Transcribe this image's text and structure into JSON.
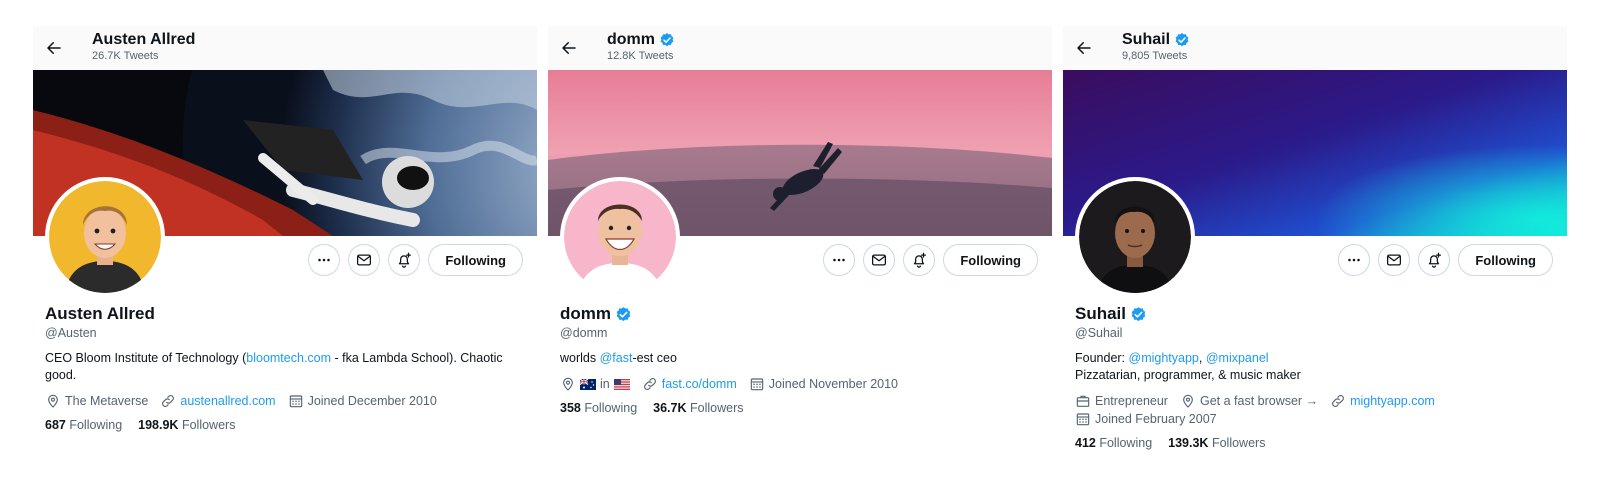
{
  "profiles": [
    {
      "top_name": "Austen Allred",
      "tweets": "26.7K Tweets",
      "verified": false,
      "name": "Austen Allred",
      "handle": "@Austen",
      "bio": {
        "p1": "CEO Bloom Institute of Technology (",
        "link": "bloomtech.com",
        "p2": " - fka Lambda School). Chaotic good."
      },
      "location": "The Metaverse",
      "website": "austenallred.com",
      "joined": "Joined December 2010",
      "following_count": "687",
      "following_label": "Following",
      "followers_count": "198.9K",
      "followers_label": "Followers",
      "follow_button": "Following",
      "banner_desc": "astronaut-in-car-over-earth",
      "avatar_bg": "#f1b82d"
    },
    {
      "top_name": "domm",
      "tweets": "12.8K Tweets",
      "verified": true,
      "name": "domm",
      "handle": "@domm",
      "bio": {
        "p1": "worlds ",
        "link": "@fast",
        "p2": "-est ceo"
      },
      "location_in": "in",
      "website": "fast.co/domm",
      "joined": "Joined November 2010",
      "following_count": "358",
      "following_label": "Following",
      "followers_count": "36.7K",
      "followers_label": "Followers",
      "follow_button": "Following",
      "banner_desc": "skydiver-pink-sky",
      "avatar_bg": "#f7b6c9"
    },
    {
      "top_name": "Suhail",
      "tweets": "9,805 Tweets",
      "verified": true,
      "name": "Suhail",
      "handle": "@Suhail",
      "bio": {
        "l1_p1": "Founder: ",
        "l1_link1": "@mightyapp",
        "l1_sep": ", ",
        "l1_link2": "@mixpanel",
        "line2": "Pizzatarian, programmer, & music maker"
      },
      "category": "Entrepreneur",
      "location": "Get a fast browser →",
      "website": "mightyapp.com",
      "joined": "Joined February 2007",
      "following_count": "412",
      "following_label": "Following",
      "followers_count": "139.3K",
      "followers_label": "Followers",
      "follow_button": "Following",
      "banner_desc": "purple-teal-gradient",
      "avatar_bg": "#1d1a1e"
    }
  ],
  "icons": {
    "back": "arrow-left-icon",
    "more": "more-dots-icon",
    "message": "mail-icon",
    "notify": "bell-plus-icon",
    "location": "location-pin-icon",
    "link": "link-icon",
    "calendar": "calendar-icon",
    "category": "briefcase-icon",
    "verified": "verified-badge-icon"
  },
  "colors": {
    "link": "#1d9bf0",
    "verified": "#1d9bf0",
    "secondary_text": "#536471",
    "primary_text": "#0f1419",
    "border": "#cfd9de"
  }
}
